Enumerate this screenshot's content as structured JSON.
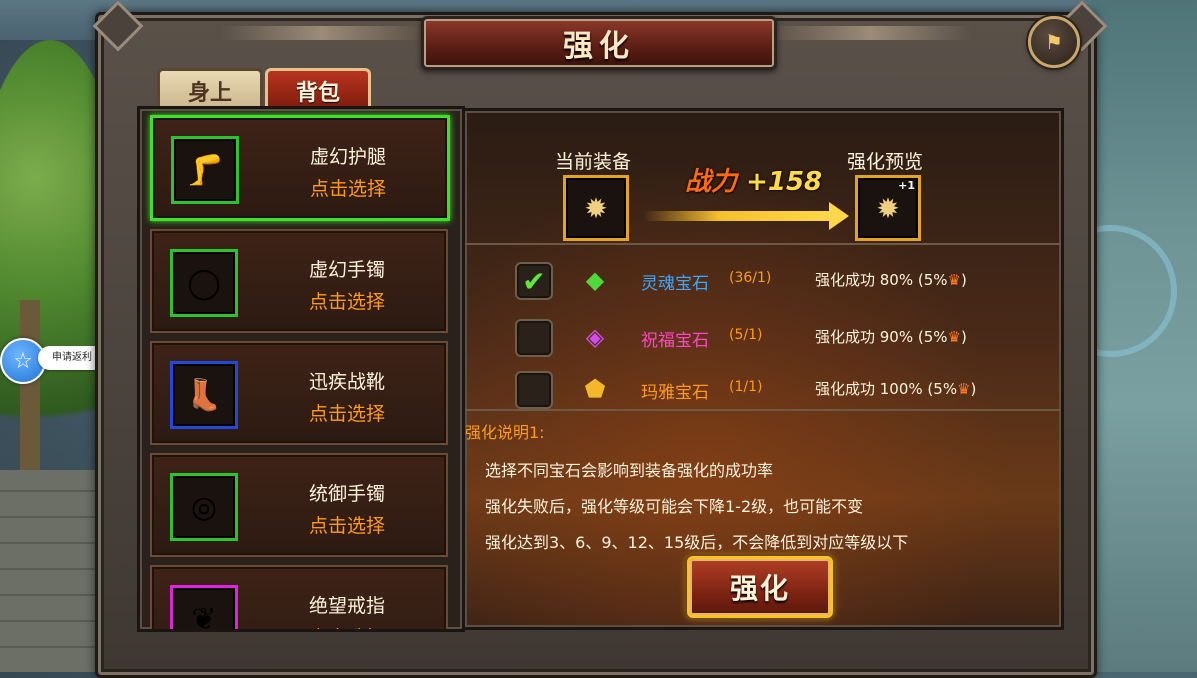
{
  "window": {
    "title": "强化",
    "close_icon": "flag-back-icon"
  },
  "tabs": [
    {
      "label": "身上",
      "active": false
    },
    {
      "label": "背包",
      "active": true
    }
  ],
  "side_badge": {
    "icon": "star-face-icon",
    "label": "申请返利"
  },
  "equipment_list": [
    {
      "name": "虚幻护腿",
      "action": "点击选择",
      "icon": "leg-armor-icon",
      "quality_color": "#2ac52a",
      "selected": true
    },
    {
      "name": "虚幻手镯",
      "action": "点击选择",
      "icon": "bracelet-icon",
      "quality_color": "#2ac52a",
      "selected": false
    },
    {
      "name": "迅疾战靴",
      "action": "点击选择",
      "icon": "boots-icon",
      "quality_color": "#1f49d8",
      "selected": false
    },
    {
      "name": "统御手镯",
      "action": "点击选择",
      "icon": "bracelet-icon",
      "quality_color": "#2ac52a",
      "selected": false
    },
    {
      "name": "绝望戒指",
      "action": "点击选择",
      "icon": "ring-icon",
      "quality_color": "#e022e0",
      "selected": false
    }
  ],
  "enhance": {
    "current_label": "当前装备",
    "preview_label": "强化预览",
    "current_item_icon": "spiked-mace-icon",
    "preview_item_icon": "spiked-mace-icon",
    "preview_level": "+1",
    "power_label": "战力",
    "power_value": "+158"
  },
  "gems": [
    {
      "name": "灵魂宝石",
      "count": "(36/1)",
      "rate": "强化成功  80% (5%",
      "checked": true,
      "color": "#3aa8ff",
      "icon": "green-gem-icon"
    },
    {
      "name": "祝福宝石",
      "count": "(5/1)",
      "rate": "强化成功  90% (5%",
      "checked": false,
      "color": "#ff45c8",
      "icon": "purple-gem-icon"
    },
    {
      "name": "玛雅宝石",
      "count": "(1/1)",
      "rate": "强化成功  100% (5%",
      "checked": false,
      "color": "#ff9a1c",
      "icon": "gold-gem-icon"
    }
  ],
  "description": {
    "title": "强化说明1:",
    "lines": [
      "选择不同宝石会影响到装备强化的成功率",
      "强化失败后，强化等级可能会下降1-2级，也可能不变",
      "强化达到3、6、9、12、15级后，不会降低到对应等级以下"
    ]
  },
  "enhance_button_label": "强化"
}
